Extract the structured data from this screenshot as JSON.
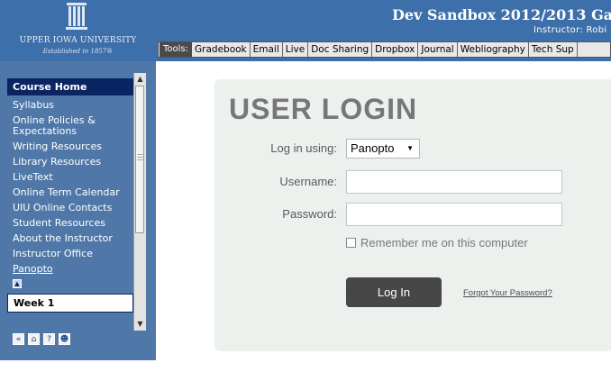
{
  "header": {
    "university": "UPPER IOWA UNIVERSITY",
    "established": "Established in 1857®",
    "course_title": "Dev Sandbox 2012/2013 Ga",
    "instructor": "Instructor: Robi"
  },
  "tools": {
    "label": "Tools:",
    "links": [
      "Gradebook",
      "Email",
      "Live",
      "Doc Sharing",
      "Dropbox",
      "Journal",
      "Webliography",
      "Tech Sup"
    ]
  },
  "sidebar": {
    "course_home": "Course Home",
    "items": [
      "Syllabus",
      "Online Policies & Expectations",
      "Writing Resources",
      "Library Resources",
      "LiveText",
      "Online Term Calendar",
      "UIU Online Contacts",
      "Student Resources",
      "About the Instructor",
      "Instructor Office",
      "Panopto"
    ],
    "week": "Week 1"
  },
  "login": {
    "title": "USER LOGIN",
    "login_using_label": "Log in using:",
    "login_using_value": "Panopto",
    "username_label": "Username:",
    "username_value": "",
    "password_label": "Password:",
    "password_value": "",
    "remember_label": "Remember me on this computer",
    "remember_checked": false,
    "button": "Log In",
    "forgot": "Forgot Your Password?"
  },
  "colors": {
    "header_bg": "#3d6faa",
    "nav_bg": "#4f78a8",
    "nav_header_bg": "#0b2563",
    "card_bg": "#edf1ee",
    "button_bg": "#474747"
  }
}
